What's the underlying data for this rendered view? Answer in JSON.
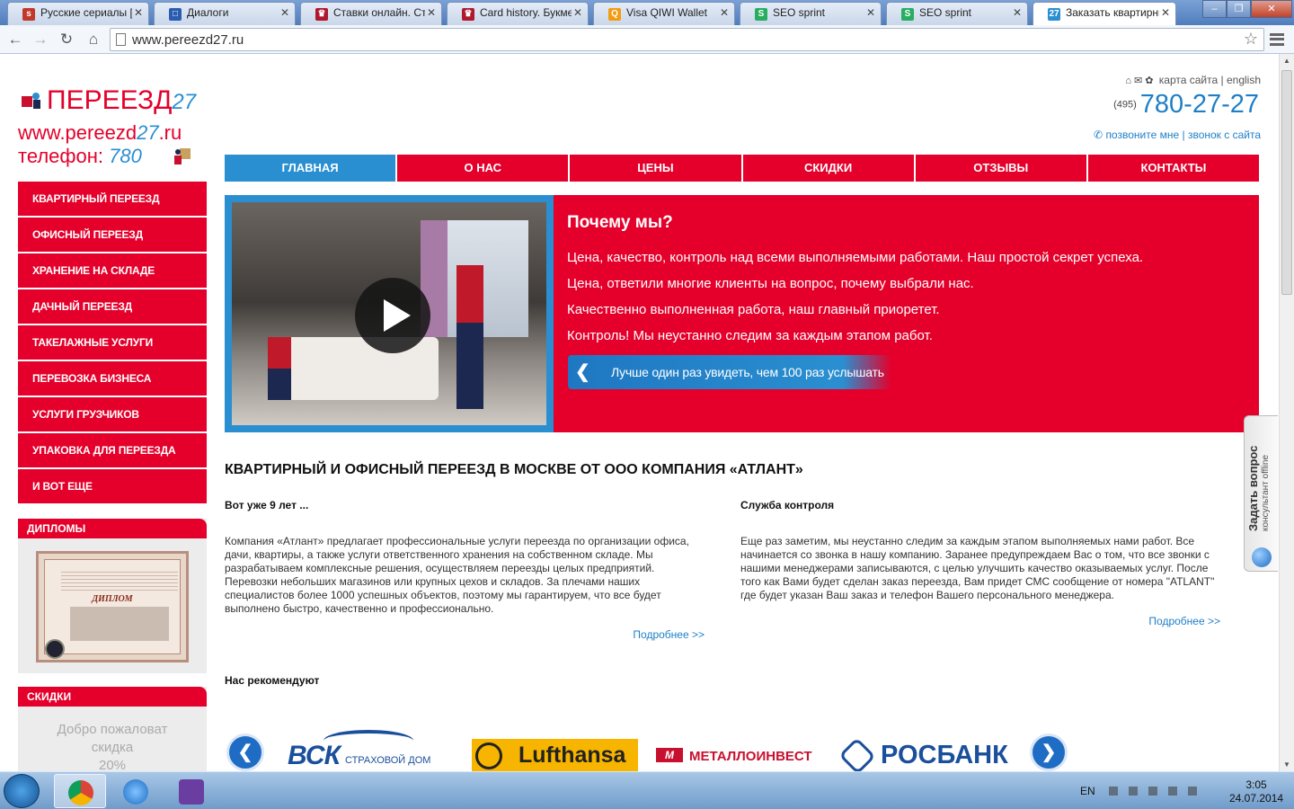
{
  "browser": {
    "tabs": [
      {
        "title": "Русские сериалы [в",
        "fav_color": "#c0392b",
        "fav_glyph": "s"
      },
      {
        "title": "Диалоги",
        "fav_color": "#2a5db0",
        "fav_glyph": "□"
      },
      {
        "title": "Ставки онлайн. Ста",
        "fav_color": "#b0182e",
        "fav_glyph": "♛"
      },
      {
        "title": "Card history. Букме",
        "fav_color": "#b0182e",
        "fav_glyph": "♛"
      },
      {
        "title": "Visa QIWI Wallet",
        "fav_color": "#f39c12",
        "fav_glyph": "Q"
      },
      {
        "title": "SEO sprint",
        "fav_color": "#27ae60",
        "fav_glyph": "S"
      },
      {
        "title": "SEO sprint",
        "fav_color": "#27ae60",
        "fav_glyph": "S"
      },
      {
        "title": "Заказать квартирнь",
        "fav_color": "#2a8fd0",
        "fav_glyph": "27",
        "active": true
      }
    ],
    "url": "www.pereezd27.ru"
  },
  "site": {
    "logo": {
      "line1": "ПЕРЕЕЗД",
      "line1_accent": "27",
      "line2": "www.pereezd",
      "line2_accent": "27",
      "line2_tail": ".ru",
      "line3": "телефон: ",
      "line3_accent": "780"
    },
    "top_links": {
      "sitemap": "карта сайта",
      "separator": "|",
      "english": "english"
    },
    "phone": {
      "code": "(495)",
      "number": "780-27-27"
    },
    "callback": {
      "call_me": "позвоните мне",
      "separator": "|",
      "call_from_site": "звонок с сайта"
    },
    "nav": [
      "ГЛАВНАЯ",
      "О НАС",
      "ЦЕНЫ",
      "СКИДКИ",
      "ОТЗЫВЫ",
      "КОНТАКТЫ"
    ],
    "sidebar": [
      "КВАРТИРНЫЙ ПЕРЕЕЗД",
      "ОФИСНЫЙ ПЕРЕЕЗД",
      "ХРАНЕНИЕ НА СКЛАДЕ",
      "ДАЧНЫЙ ПЕРЕЕЗД",
      "ТАКЕЛАЖНЫЕ УСЛУГИ",
      "ПЕРЕВОЗКА БИЗНЕСА",
      "УСЛУГИ ГРУЗЧИКОВ",
      "УПАКОВКА ДЛЯ ПЕРЕЕЗДА",
      "И ВОТ ЕЩЕ"
    ],
    "diplomas": {
      "title": "ДИПЛОМЫ",
      "caption": "ДИПЛОМ"
    },
    "discounts": {
      "title": "СКИДКИ",
      "text_line1": "Добро пожаловат",
      "text_line2": "скидка",
      "text_line3": "20%"
    },
    "banner": {
      "title": "Почему мы?",
      "lines": [
        "Цена, качество, контроль над всеми выполняемыми работами. Наш простой секрет успеха.",
        "Цена, ответили многие клиенты на вопрос, почему выбрали нас.",
        "Качественно выполненная работа, наш главный приоретет.",
        "Контроль! Мы неустанно следим за каждым этапом работ."
      ],
      "cta": "Лучше один раз увидеть, чем 100 раз услышать"
    },
    "heading": "КВАРТИРНЫЙ И ОФИСНЫЙ ПЕРЕЕЗД В МОСКВЕ ОТ ООО КОМПАНИЯ «АТЛАНТ»",
    "col1": {
      "title": "Вот уже 9 лет ...",
      "text": "Компания «Атлант» предлагает профессиональные услуги переезда по организации офиса, дачи, квартиры, а также услуги ответственного хранения на собственном складе. Мы разрабатываем комплексные решения, осуществляем переезды целых предприятий. Перевозки небольших магазинов или крупных цехов и складов. За плечами наших специалистов более 1000 успешных объектов, поэтому мы гарантируем, что все будет выполнено быстро, качественно и профессионально.",
      "more": "Подробнее >>"
    },
    "col2": {
      "title": "Служба контроля",
      "text": "Еще раз заметим, мы неустанно следим за каждым этапом выполняемых нами работ. Все начинается со звонка в нашу компанию. Заранее предупреждаем Вас о том, что все звонки с нашими менеджерами записываются, с целью улучшить качество оказываемых услуг. После того как Вами будет сделан заказ переезда, Вам придет СМС сообщение от номера \"ATLANT\" где будет указан Ваш заказ и телефон Вашего персонального менеджера.",
      "more": "Подробнее >>"
    },
    "recommend": "Нас рекомендуют",
    "partners": {
      "vsk": "ВСК",
      "vsk_sub": "СТРАХОВОЙ ДОМ",
      "lufthansa": "Lufthansa",
      "metall": "МЕТАЛЛОИНВЕСТ",
      "metall_mark": "M",
      "rosbank": "РОСБАНК"
    },
    "ask": {
      "title": "Задать вопрос",
      "status": "консультант offline"
    }
  },
  "taskbar": {
    "lang": "EN",
    "time": "3:05",
    "date": "24.07.2014"
  },
  "colors": {
    "brand_red": "#e4002b",
    "brand_blue": "#2a8fd0"
  }
}
